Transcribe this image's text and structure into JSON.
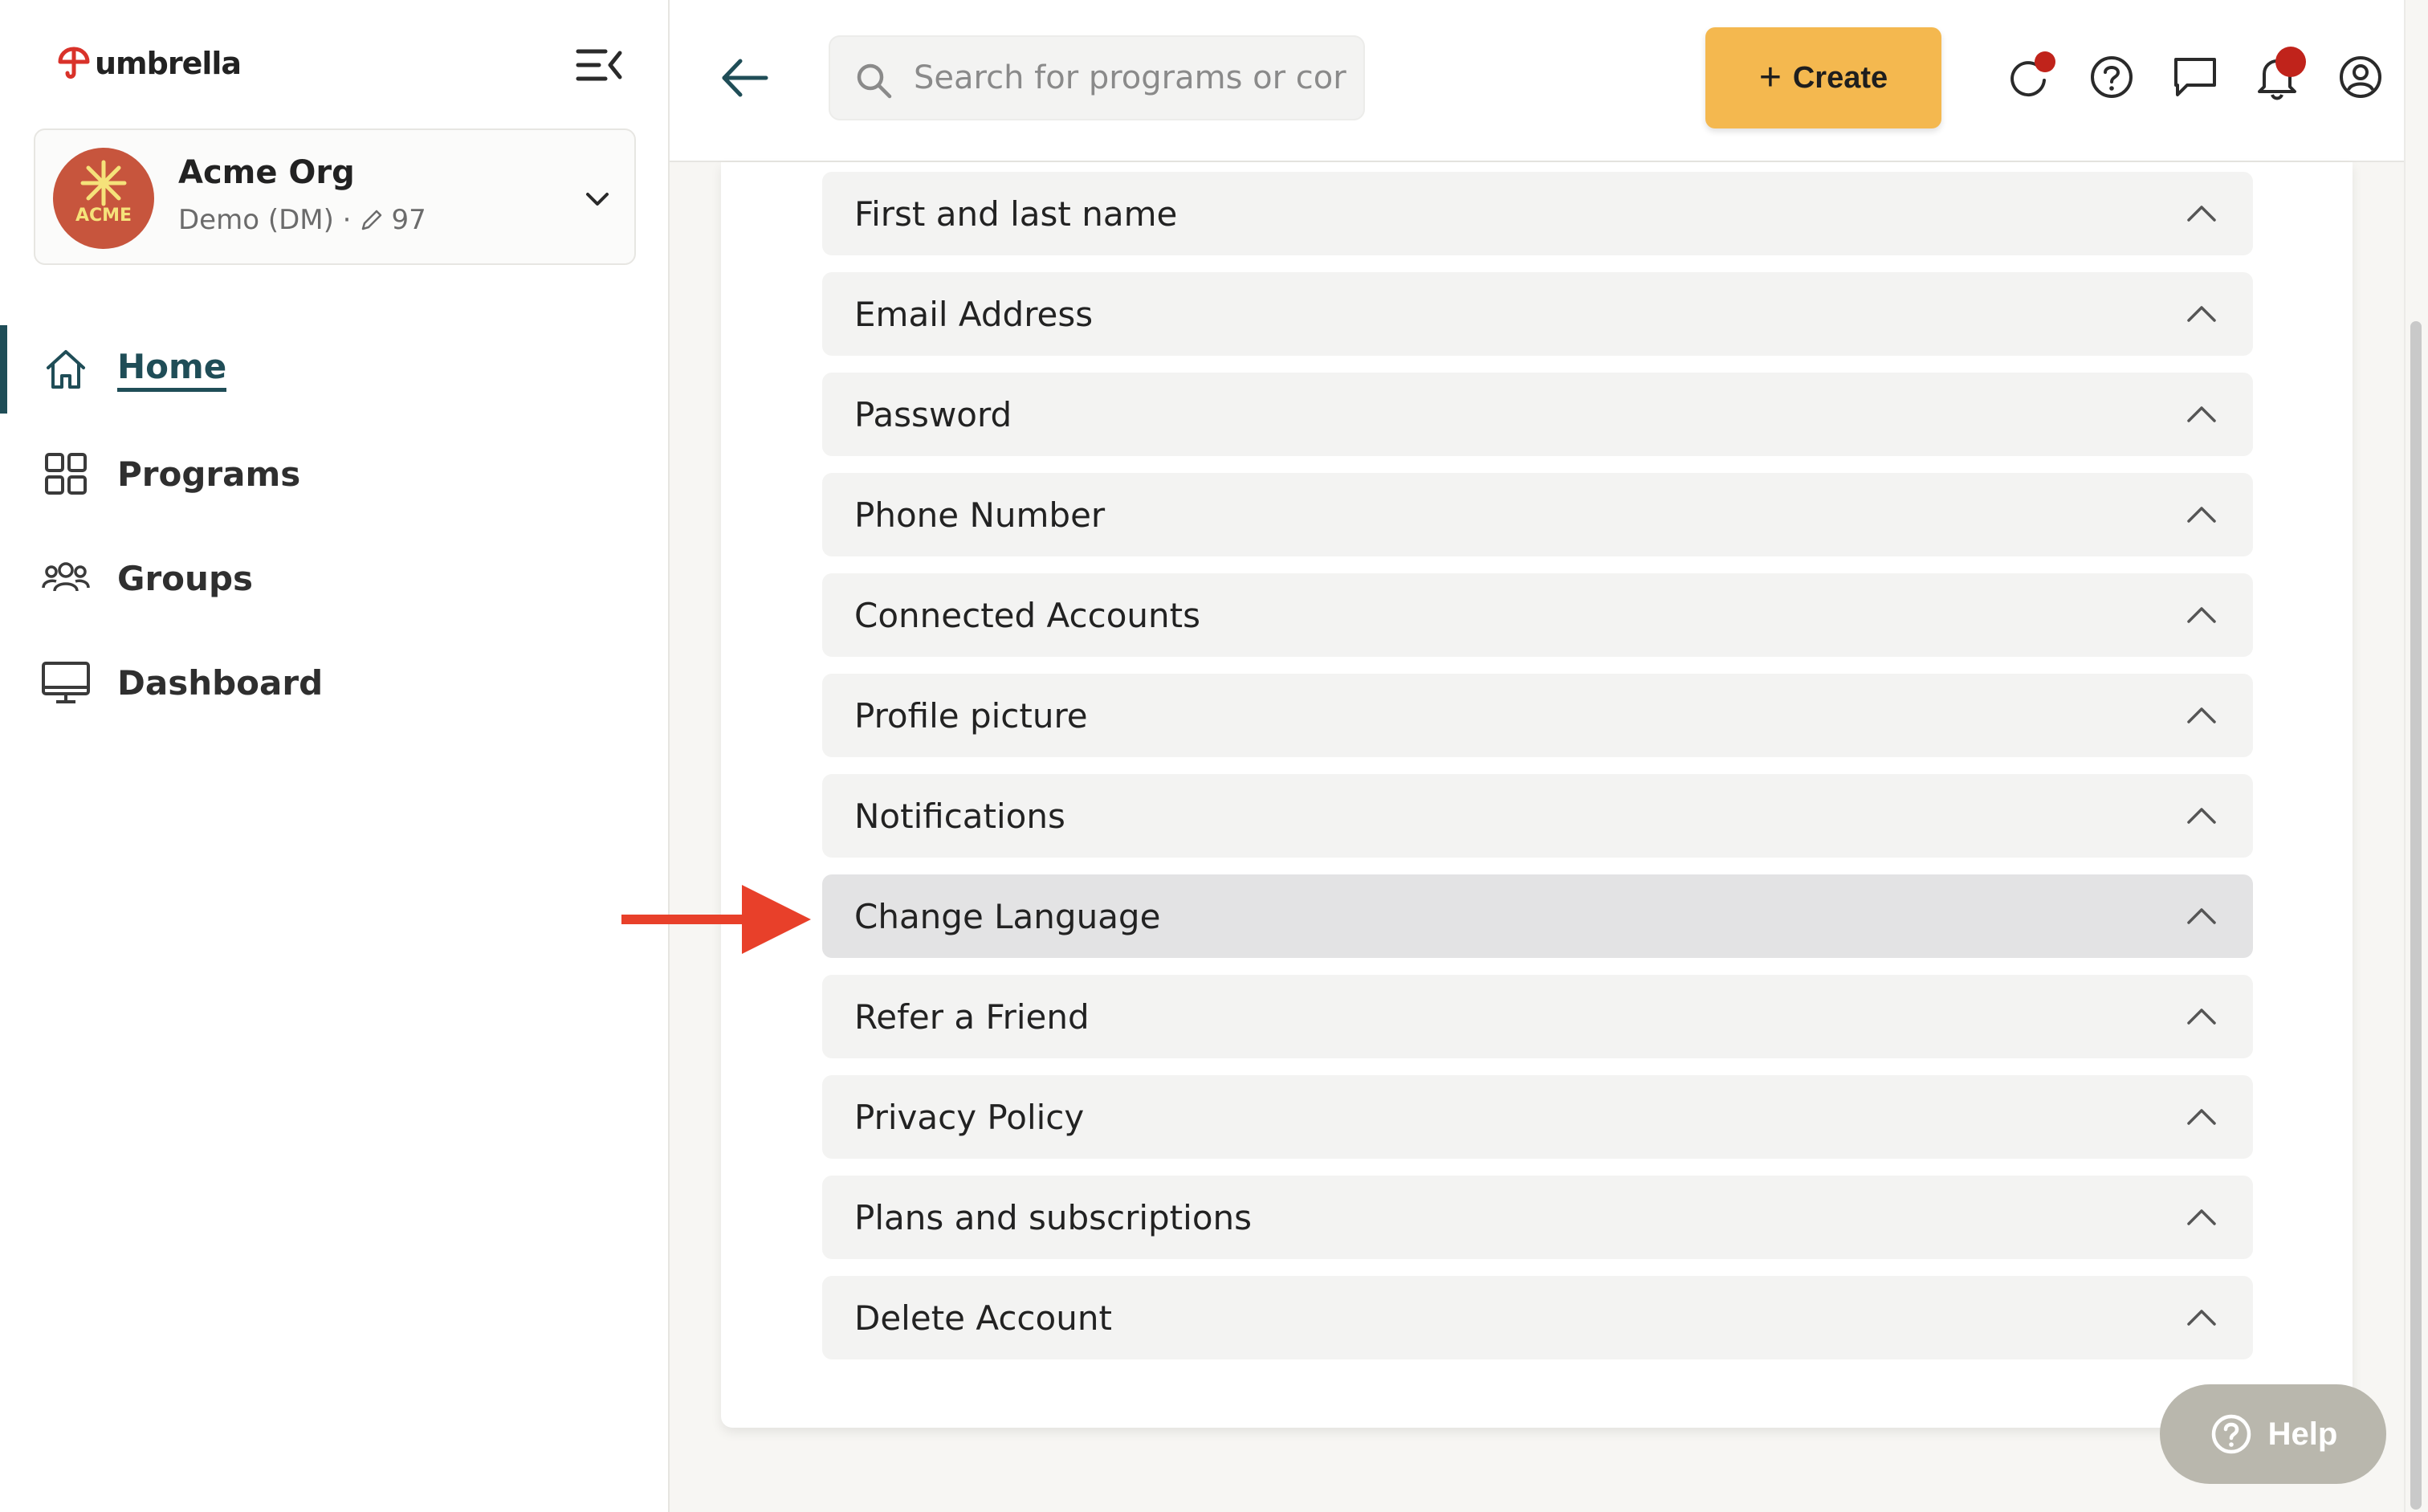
{
  "app": {
    "brand_name": "umbrella"
  },
  "org": {
    "avatar_text": "ACME",
    "name": "Acme Org",
    "sub_label": "Demo (DM) ·",
    "count": "97"
  },
  "sidebar": {
    "items": [
      {
        "label": "Home",
        "icon": "home-icon",
        "active": true
      },
      {
        "label": "Programs",
        "icon": "grid-icon",
        "active": false
      },
      {
        "label": "Groups",
        "icon": "users-icon",
        "active": false
      },
      {
        "label": "Dashboard",
        "icon": "monitor-icon",
        "active": false
      }
    ]
  },
  "topbar": {
    "search_placeholder": "Search for programs or cor",
    "create_label": "Create"
  },
  "settings": {
    "items": [
      {
        "label": "First and last name"
      },
      {
        "label": "Email Address"
      },
      {
        "label": "Password"
      },
      {
        "label": "Phone Number"
      },
      {
        "label": "Connected Accounts"
      },
      {
        "label": "Profile picture"
      },
      {
        "label": "Notifications"
      },
      {
        "label": "Change Language",
        "highlighted": true
      },
      {
        "label": "Refer a Friend"
      },
      {
        "label": "Privacy Policy"
      },
      {
        "label": "Plans and subscriptions"
      },
      {
        "label": "Delete Account"
      }
    ]
  },
  "help": {
    "label": "Help"
  },
  "colors": {
    "accent": "#1f4d57",
    "create_button": "#f4b84f",
    "notification_dot": "#c0231b",
    "annotation_arrow": "#e8402a",
    "help_button": "#b9b7ad"
  }
}
